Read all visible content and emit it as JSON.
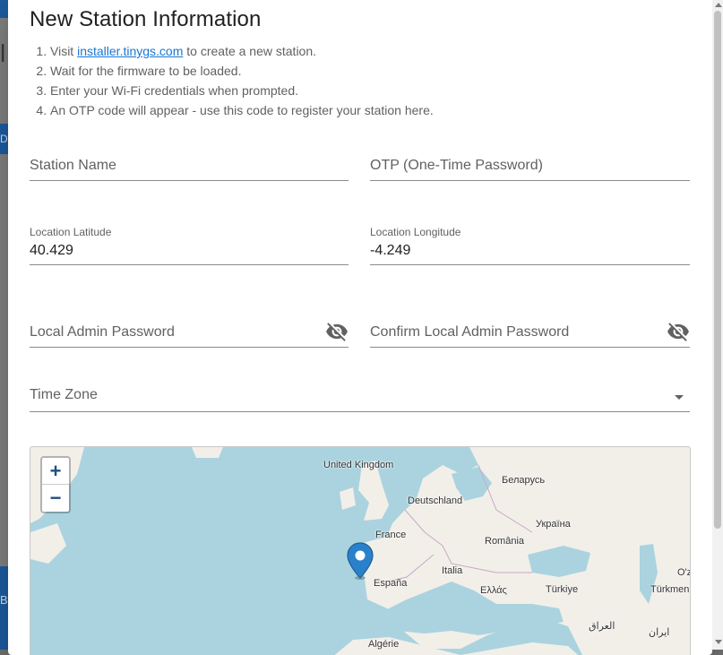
{
  "background": {
    "side_letter": "B"
  },
  "dialog": {
    "title": "New Station Information",
    "steps": [
      {
        "prefix": "Visit ",
        "link": "installer.tinygs.com",
        "suffix": " to create a new station."
      },
      {
        "text": "Wait for the firmware to be loaded."
      },
      {
        "text": "Enter your Wi-Fi credentials when prompted."
      },
      {
        "text": "An OTP code will appear - use this code to register your station here."
      }
    ],
    "fields": {
      "station_name": {
        "label": "Station Name",
        "value": ""
      },
      "otp": {
        "label": "OTP (One-Time Password)",
        "value": ""
      },
      "latitude": {
        "label": "Location Latitude",
        "value": "40.429"
      },
      "longitude": {
        "label": "Location Longitude",
        "value": "-4.249"
      },
      "admin_password": {
        "label": "Local Admin Password",
        "value": ""
      },
      "confirm_password": {
        "label": "Confirm Local Admin Password",
        "value": ""
      },
      "time_zone": {
        "label": "Time Zone",
        "value": ""
      }
    }
  },
  "map": {
    "zoom_in": "+",
    "zoom_out": "−",
    "labels": [
      {
        "text": "United Kingdom"
      },
      {
        "text": "Беларусь"
      },
      {
        "text": "Deutschland"
      },
      {
        "text": "Україна"
      },
      {
        "text": "France"
      },
      {
        "text": "România"
      },
      {
        "text": "Italia"
      },
      {
        "text": "Ελλάς"
      },
      {
        "text": "Türkiye"
      },
      {
        "text": "España"
      },
      {
        "text": "Türkmen"
      },
      {
        "text": "O'z"
      },
      {
        "text": "العراق"
      },
      {
        "text": "ایران"
      },
      {
        "text": "Algérie"
      }
    ],
    "colors": {
      "water": "#aad3df",
      "land": "#f2efe9",
      "marker": "#2a81cb"
    }
  }
}
